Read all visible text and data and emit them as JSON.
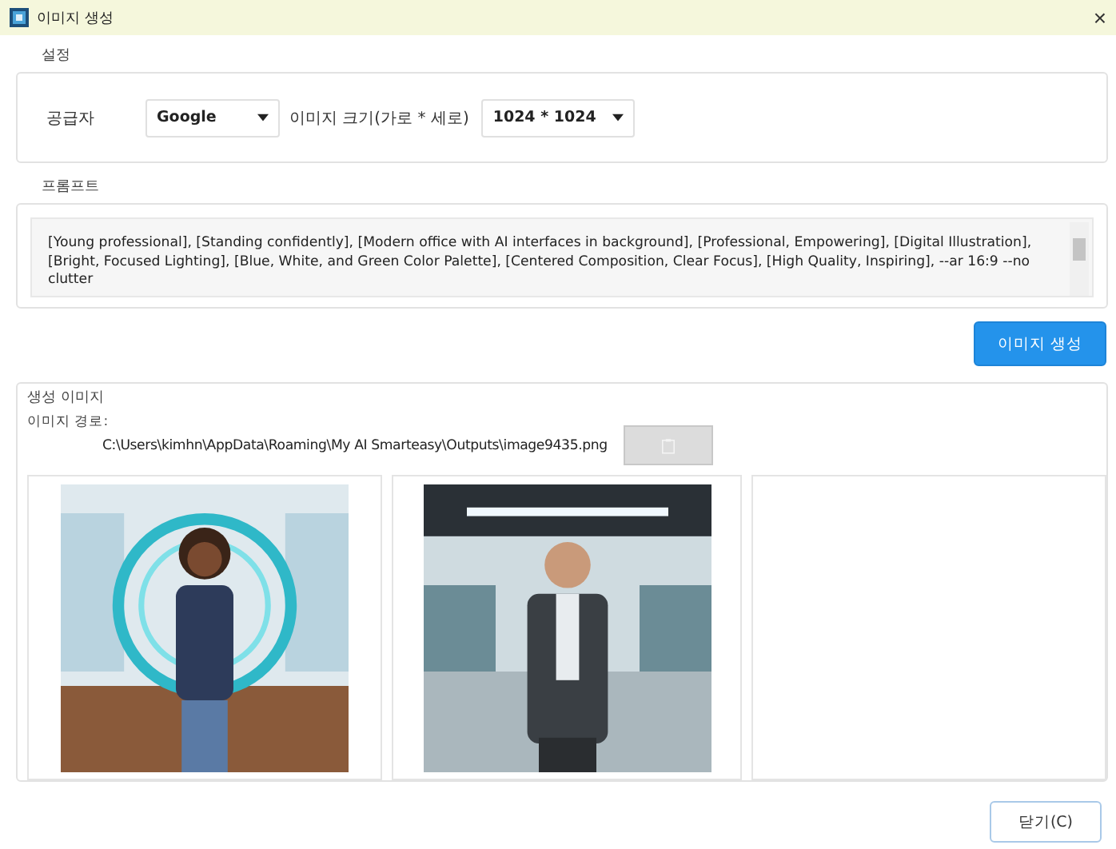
{
  "window": {
    "title": "이미지 생성",
    "close": "×"
  },
  "settings": {
    "label": "설정",
    "provider_label": "공급자",
    "provider": "Google",
    "size_label": "이미지 크기(가로 * 세로)",
    "size": "1024 * 1024"
  },
  "prompt": {
    "label": "프롬프트",
    "value": "[Young professional], [Standing confidently], [Modern office with AI interfaces in background], [Professional, Empowering], [Digital Illustration], [Bright, Focused Lighting], [Blue, White, and Green Color Palette], [Centered Composition, Clear Focus], [High Quality, Inspiring], --ar 16:9 --no clutter"
  },
  "generate_button": "이미지 생성",
  "generated": {
    "label": "생성 이미지",
    "path_label": "이미지 경로:",
    "path": "C:\\Users\\kimhn\\AppData\\Roaming\\My AI Smarteasy\\Outputs\\image9435.png",
    "copy_disabled": true,
    "images": [
      {
        "kind": "picture"
      },
      {
        "kind": "picture"
      },
      {
        "kind": "empty"
      }
    ]
  },
  "close_button": "닫기(C)"
}
